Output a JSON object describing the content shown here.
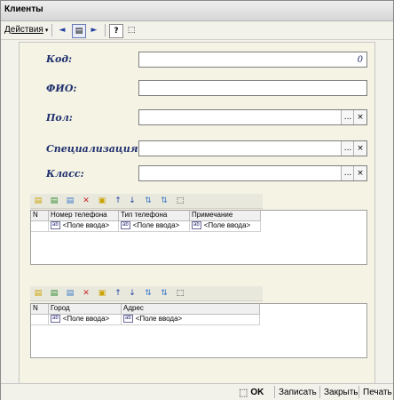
{
  "window": {
    "title": "Клиенты"
  },
  "toolbar": {
    "actions_label": "Действия",
    "actions_caret": "▾",
    "icons": {
      "back": "◄",
      "filter": "▤",
      "forward": "►",
      "help": "?",
      "select": "⬚"
    }
  },
  "form": {
    "code_label": "Код:",
    "code_value": "0",
    "fio_label": "ФИО:",
    "gender_label": "Пол:",
    "spec_label": "Специализация:",
    "class_label": "Класс:",
    "ellipsis": "...",
    "clear": "×"
  },
  "phones_table": {
    "headers": [
      "N",
      "Номер телефона",
      "Тип телефона",
      "Примечание"
    ],
    "row": [
      "",
      "<Поле ввода>",
      "<Поле ввода>",
      "<Поле ввода>"
    ]
  },
  "cities_table": {
    "headers": [
      "N",
      "Город",
      "Адрес"
    ],
    "row": [
      "",
      "<Поле ввода>",
      "<Поле ввода>"
    ]
  },
  "grid_icon_ab": "ab",
  "statusbar": {
    "ok": "OK",
    "save": "Записать",
    "close": "Закрыть",
    "print": "Печать"
  }
}
